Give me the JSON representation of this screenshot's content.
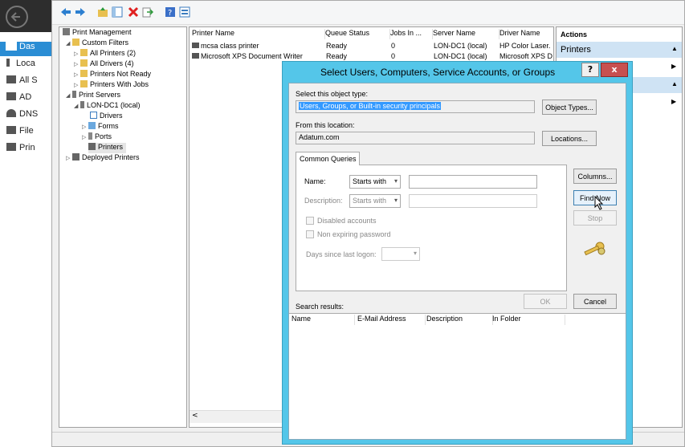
{
  "server_manager": {
    "sidebar": [
      {
        "label": "Das",
        "icon": "dashboard-icon",
        "active": true
      },
      {
        "label": "Loca",
        "icon": "server-icon"
      },
      {
        "label": "All S",
        "icon": "servers-icon"
      },
      {
        "label": "AD",
        "icon": "ad-icon"
      },
      {
        "label": "DNS",
        "icon": "dns-icon"
      },
      {
        "label": "File",
        "icon": "file-icon"
      },
      {
        "label": "Prin",
        "icon": "printer-icon"
      }
    ]
  },
  "print_management": {
    "tree": [
      {
        "label": "Print Management",
        "icon": "print-management-icon"
      },
      {
        "label": "Custom Filters",
        "icon": "filter-folder-icon",
        "expander": "◢"
      },
      {
        "label": "All Printers (2)",
        "icon": "filter-icon",
        "expander": "▷"
      },
      {
        "label": "All Drivers (4)",
        "icon": "filter-icon",
        "expander": "▷"
      },
      {
        "label": "Printers Not Ready",
        "icon": "filter-icon",
        "expander": "▷"
      },
      {
        "label": "Printers With Jobs",
        "icon": "filter-icon",
        "expander": "▷"
      },
      {
        "label": "Print Servers",
        "icon": "server-icon",
        "expander": "◢"
      },
      {
        "label": "LON-DC1 (local)",
        "icon": "server-icon",
        "expander": "◢"
      },
      {
        "label": "Drivers",
        "icon": "drivers-icon"
      },
      {
        "label": "Forms",
        "icon": "forms-icon",
        "expander": "▷"
      },
      {
        "label": "Ports",
        "icon": "ports-icon",
        "expander": "▷"
      },
      {
        "label": "Printers",
        "icon": "printer-icon",
        "selected": true
      },
      {
        "label": "Deployed Printers",
        "icon": "printer-icon",
        "expander": "▷"
      }
    ],
    "columns": [
      "Printer Name",
      "Queue Status",
      "Jobs In ...",
      "Server Name",
      "Driver Name"
    ],
    "rows": [
      [
        "mcsa class printer",
        "Ready",
        "0",
        "LON-DC1 (local)",
        "HP Color Laser."
      ],
      [
        "Microsoft XPS Document Writer",
        "Ready",
        "0",
        "LON-DC1 (local)",
        "Microsoft XPS D"
      ]
    ],
    "actions": {
      "header": "Actions",
      "section1": "Printers",
      "section2_partial": "er"
    }
  },
  "dialog": {
    "title": "Select Users, Computers, Service Accounts, or Groups",
    "help": "?",
    "close": "x",
    "object_type_label": "Select this object type:",
    "object_type_value": "Users, Groups, or Built-in security principals",
    "object_types_button": "Object Types...",
    "location_label": "From this location:",
    "location_value": "Adatum.com",
    "locations_button": "Locations...",
    "tab": "Common Queries",
    "name_label": "Name:",
    "name_mode": "Starts with",
    "description_label": "Description:",
    "description_mode": "Starts with",
    "disabled_accounts": "Disabled accounts",
    "non_expiring": "Non expiring password",
    "days_label": "Days since last logon:",
    "columns_button": "Columns...",
    "find_now_button": "Find Now",
    "stop_button": "Stop",
    "ok_button": "OK",
    "cancel_button": "Cancel",
    "search_results_label": "Search results:",
    "result_columns": [
      "Name",
      "E-Mail Address",
      "Description",
      "In Folder"
    ]
  }
}
